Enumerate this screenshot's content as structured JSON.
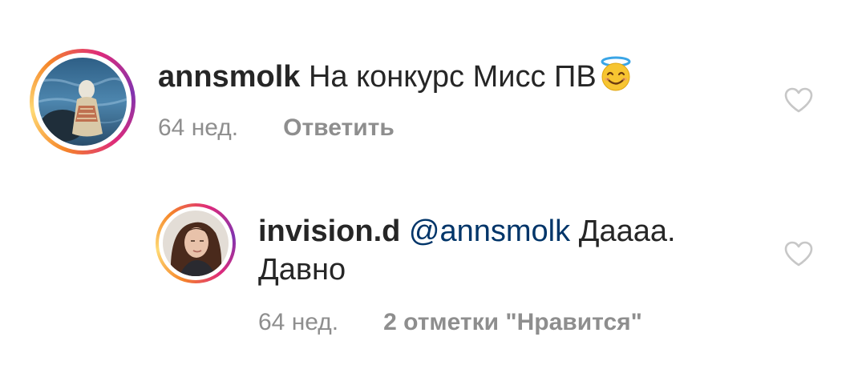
{
  "comments": [
    {
      "username": "annsmolk",
      "text": "На конкурс Мисс ПВ",
      "emoji": "smiling-face-with-halo-icon",
      "time": "64 нед.",
      "action": "Ответить"
    },
    {
      "username": "invision.d",
      "mention": "@annsmolk",
      "text_line1": "Даааа.",
      "text_line2": "Давно",
      "time": "64 нед.",
      "likes": "2 отметки \"Нравится\""
    }
  ],
  "colors": {
    "username": "#262626",
    "mention": "#003569",
    "meta": "#8e8e8e",
    "heart": "#c7c7c7"
  }
}
